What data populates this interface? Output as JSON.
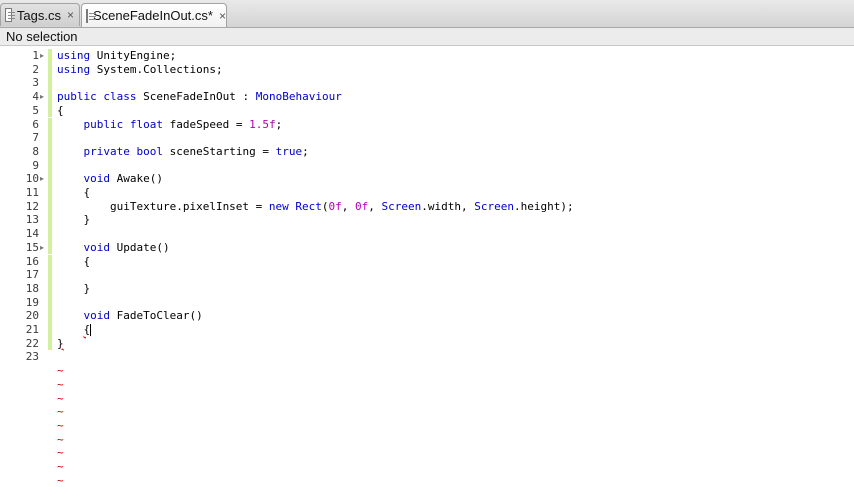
{
  "tabs": [
    {
      "label": "Tags.cs",
      "close": "×",
      "active": false
    },
    {
      "label": "SceneFadeInOut.cs*",
      "close": "×",
      "active": true
    }
  ],
  "status": {
    "text": "No selection"
  },
  "code_lines": [
    {
      "n": "1",
      "tokens": [
        {
          "t": "using",
          "c": "kw"
        },
        {
          "t": " UnityEngine;"
        }
      ]
    },
    {
      "n": "2",
      "tokens": [
        {
          "t": "using",
          "c": "kw"
        },
        {
          "t": " System.Collections;"
        }
      ]
    },
    {
      "n": "3",
      "tokens": []
    },
    {
      "n": "4",
      "tokens": [
        {
          "t": "public",
          "c": "kw"
        },
        {
          "t": " "
        },
        {
          "t": "class",
          "c": "kw"
        },
        {
          "t": " SceneFadeInOut : "
        },
        {
          "t": "MonoBehaviour",
          "c": "kw"
        }
      ]
    },
    {
      "n": "5",
      "tokens": [
        {
          "t": "{"
        }
      ]
    },
    {
      "n": "6",
      "tokens": [
        {
          "t": "    "
        },
        {
          "t": "public",
          "c": "kw"
        },
        {
          "t": " "
        },
        {
          "t": "float",
          "c": "kw"
        },
        {
          "t": " fadeSpeed = "
        },
        {
          "t": "1.5f",
          "c": "num"
        },
        {
          "t": ";"
        }
      ]
    },
    {
      "n": "7",
      "tokens": []
    },
    {
      "n": "8",
      "tokens": [
        {
          "t": "    "
        },
        {
          "t": "private",
          "c": "kw"
        },
        {
          "t": " "
        },
        {
          "t": "bool",
          "c": "kw"
        },
        {
          "t": " sceneStarting = "
        },
        {
          "t": "true",
          "c": "kw"
        },
        {
          "t": ";"
        }
      ]
    },
    {
      "n": "9",
      "tokens": []
    },
    {
      "n": "10",
      "tokens": [
        {
          "t": "    "
        },
        {
          "t": "void",
          "c": "kw"
        },
        {
          "t": " Awake()"
        }
      ]
    },
    {
      "n": "11",
      "tokens": [
        {
          "t": "    {"
        }
      ]
    },
    {
      "n": "12",
      "tokens": [
        {
          "t": "        guiTexture.pixelInset = "
        },
        {
          "t": "new",
          "c": "kw"
        },
        {
          "t": " "
        },
        {
          "t": "Rect",
          "c": "kw"
        },
        {
          "t": "("
        },
        {
          "t": "0f",
          "c": "num"
        },
        {
          "t": ", "
        },
        {
          "t": "0f",
          "c": "num"
        },
        {
          "t": ", "
        },
        {
          "t": "Screen",
          "c": "kw"
        },
        {
          "t": ".width, "
        },
        {
          "t": "Screen",
          "c": "kw"
        },
        {
          "t": ".height);"
        }
      ]
    },
    {
      "n": "13",
      "tokens": [
        {
          "t": "    }"
        }
      ]
    },
    {
      "n": "14",
      "tokens": []
    },
    {
      "n": "15",
      "tokens": [
        {
          "t": "    "
        },
        {
          "t": "void",
          "c": "kw"
        },
        {
          "t": " Update()"
        }
      ]
    },
    {
      "n": "16",
      "tokens": [
        {
          "t": "    {"
        }
      ]
    },
    {
      "n": "17",
      "tokens": []
    },
    {
      "n": "18",
      "tokens": [
        {
          "t": "    }"
        }
      ]
    },
    {
      "n": "19",
      "tokens": []
    },
    {
      "n": "20",
      "tokens": [
        {
          "t": "    "
        },
        {
          "t": "void",
          "c": "kw"
        },
        {
          "t": " FadeToClear()"
        }
      ]
    },
    {
      "n": "21",
      "tokens": [
        {
          "t": "    "
        },
        {
          "t": "{",
          "c": "err"
        },
        {
          "t": "",
          "c": "cursor"
        }
      ]
    },
    {
      "n": "22",
      "tokens": [
        {
          "t": "}",
          "c": "err"
        }
      ]
    },
    {
      "n": "23",
      "tokens": []
    }
  ],
  "folds": [
    "1",
    "4",
    "10",
    "15"
  ],
  "changed_lines": [
    "1",
    "2",
    "3",
    "4",
    "5",
    "6",
    "7",
    "8",
    "9",
    "10",
    "11",
    "12",
    "13",
    "14",
    "15",
    "16",
    "17",
    "18",
    "19",
    "20",
    "21",
    "22"
  ],
  "empty_marker": "~",
  "empty_count": 9,
  "colors": {
    "keyword": "#0000cc",
    "number": "#b000b0",
    "change_bar": "#d3f0a0",
    "tilde": "#c00000"
  }
}
